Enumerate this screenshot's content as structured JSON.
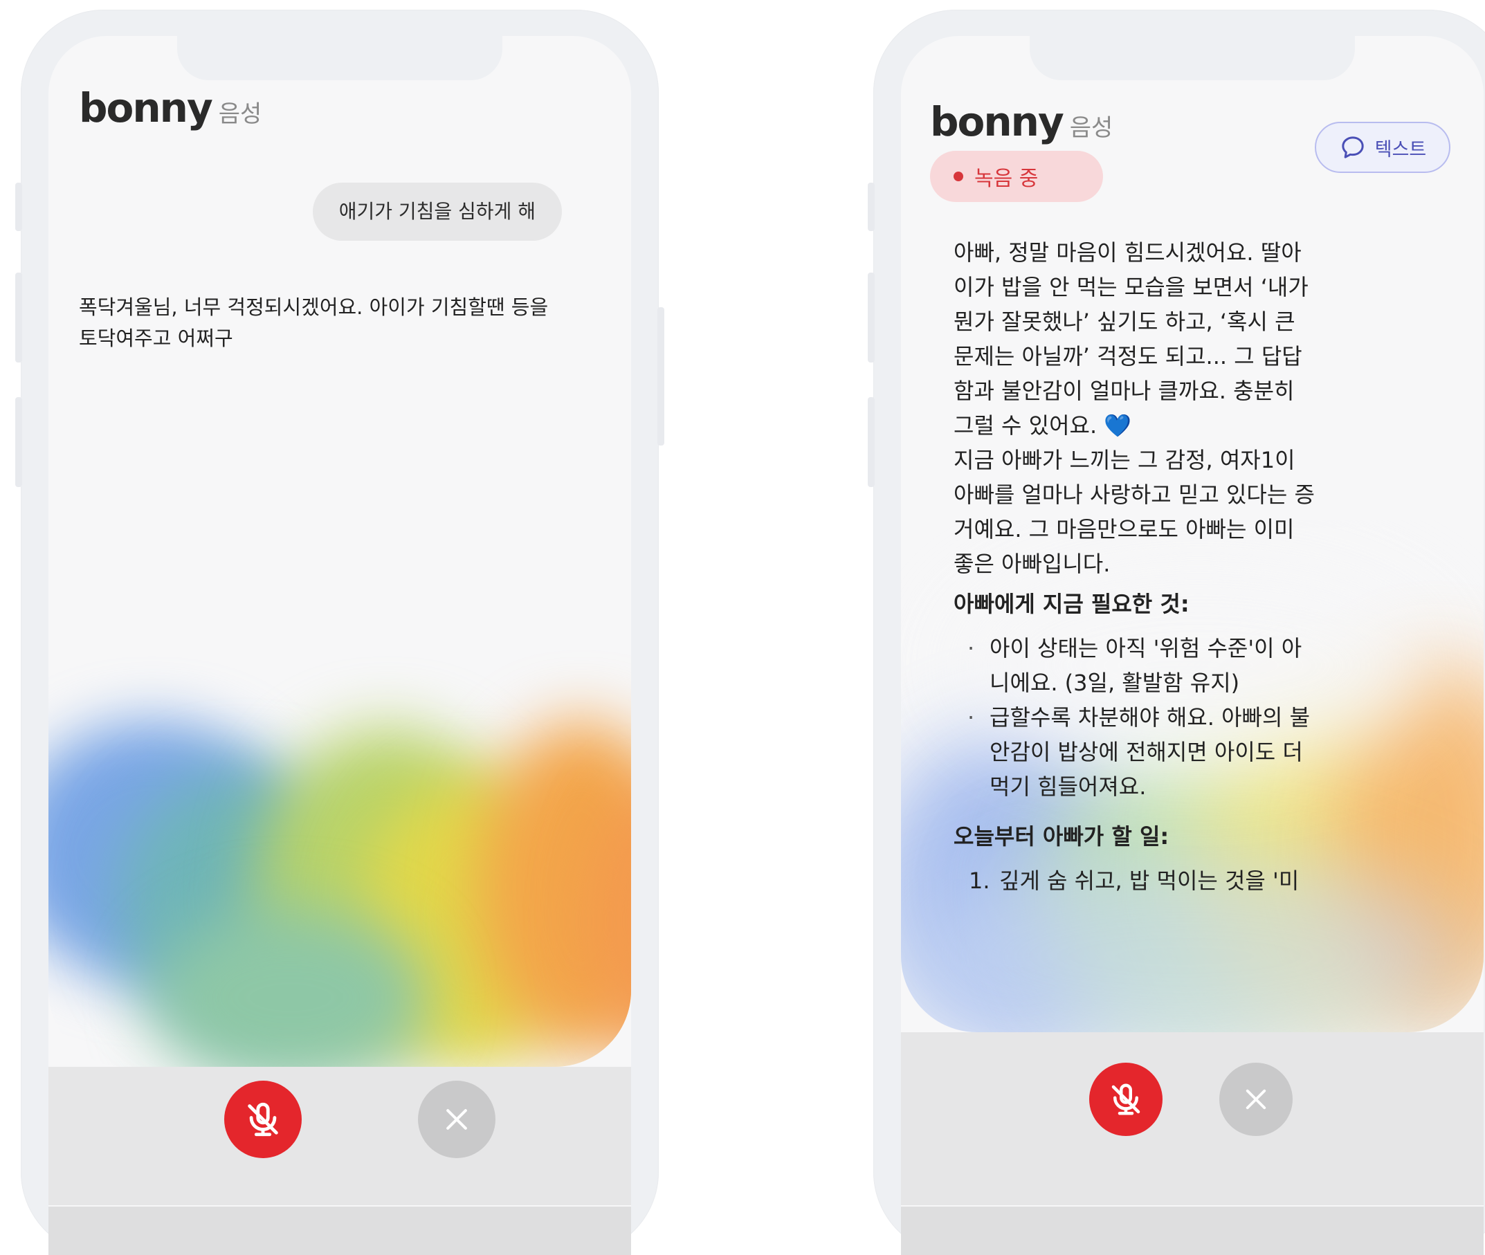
{
  "left_screen": {
    "brand": {
      "logo": "bonny",
      "mode": "음성"
    },
    "user_message": "애기가 기침을 심하게 해",
    "assistant_message_line1": "폭닥겨울님, 너무 걱정되시겠어요. 아이가 기침할땐 등을",
    "assistant_message_line2": "토닥여주고 어쩌구",
    "controls": {
      "mic_icon": "mic-off-icon",
      "close_icon": "close-icon"
    }
  },
  "right_screen": {
    "brand": {
      "logo": "bonny",
      "mode": "음성"
    },
    "status": "녹음 중",
    "text_toggle": {
      "label": "텍스트",
      "icon": "chat-bubble-icon"
    },
    "reply": {
      "p1_lines": [
        "아빠, 정말 마음이 힘드시겠어요. 딸아",
        "이가 밥을 안 먹는 모습을 보면서 ‘내가",
        "뭔가 잘못했나’ 싶기도 하고, ‘혹시 큰",
        "문제는 아닐까’ 걱정도 되고... 그 답답",
        "함과 불안감이 얼마나 클까요. 충분히"
      ],
      "p1_last": "그럴 수 있어요.",
      "heart": "💙",
      "p2_lines": [
        "지금 아빠가 느끼는 그 감정, 여자1이",
        "아빠를 얼마나 사랑하고 믿고 있다는 증",
        "거예요. 그 마음만으로도 아빠는 이미",
        "좋은 아빠입니다."
      ],
      "heading1": "아빠에게 지금 필요한 것:",
      "bullets": [
        [
          "아이 상태는 아직 '위험 수준'이 아",
          "니에요. (3일, 활발함 유지)"
        ],
        [
          "급할수록 차분해야 해요. 아빠의 불",
          "안감이 밥상에 전해지면 아이도 더",
          "먹기 힘들어져요."
        ]
      ],
      "heading2": "오늘부터 아빠가 할 일:",
      "steps": [
        {
          "num": "1.",
          "text": "깊게 숨 쉬고, 밥 먹이는 것을 '미"
        }
      ]
    },
    "controls": {
      "mic_icon": "mic-off-icon",
      "close_icon": "close-icon"
    }
  }
}
